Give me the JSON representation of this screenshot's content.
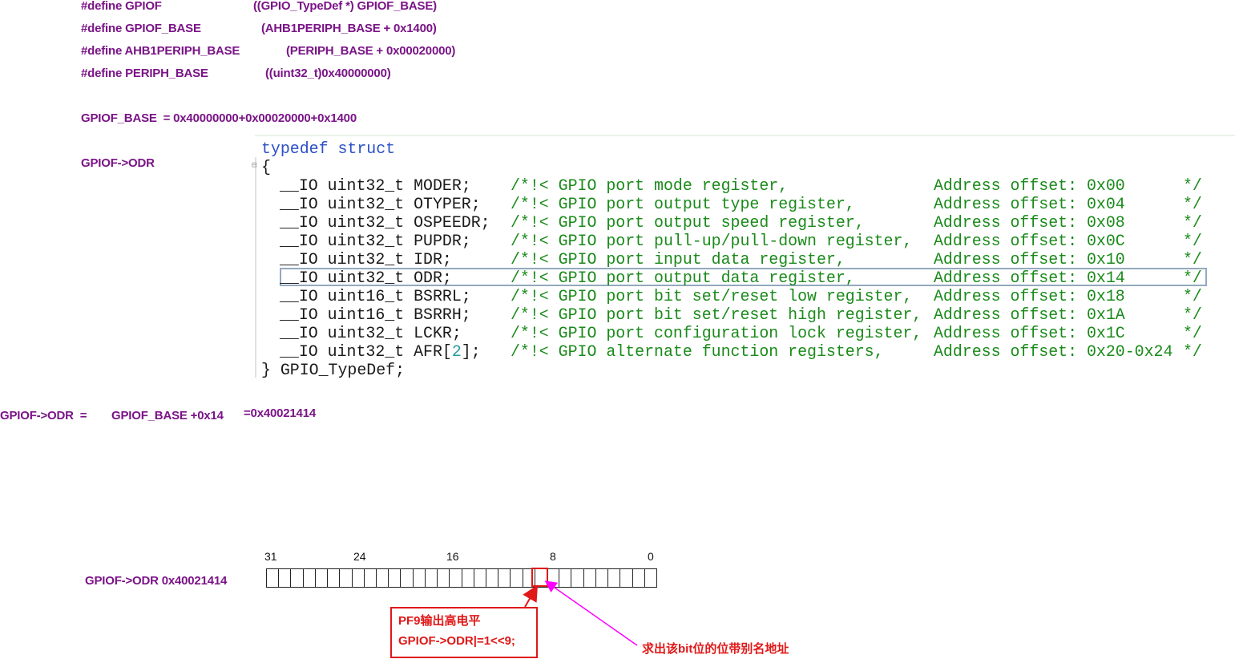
{
  "defines": [
    {
      "name": "#define GPIOF",
      "value": "((GPIO_TypeDef *) GPIOF_BASE)"
    },
    {
      "name": "#define GPIOF_BASE",
      "value": "(AHB1PERIPH_BASE + 0x1400)"
    },
    {
      "name": "#define AHB1PERIPH_BASE",
      "value": "(PERIPH_BASE + 0x00020000)"
    },
    {
      "name": "#define PERIPH_BASE",
      "value": "((uint32_t)0x40000000)"
    }
  ],
  "gpiof_base_calc": "GPIOF_BASE  = 0x40000000+0x00020000+0x1400",
  "gpiof_odr_label": "GPIOF->ODR",
  "code": {
    "header": "typedef struct",
    "open_brace": "{",
    "fold_marker": "⊟",
    "fields": [
      {
        "decl": "__IO uint32_t MODER;",
        "comment": "/*!< GPIO port mode register,",
        "offset": "Address offset: 0x00",
        "end": "*/"
      },
      {
        "decl": "__IO uint32_t OTYPER;",
        "comment": "/*!< GPIO port output type register,",
        "offset": "Address offset: 0x04",
        "end": "*/"
      },
      {
        "decl": "__IO uint32_t OSPEEDR;",
        "comment": "/*!< GPIO port output speed register,",
        "offset": "Address offset: 0x08",
        "end": "*/"
      },
      {
        "decl": "__IO uint32_t PUPDR;",
        "comment": "/*!< GPIO port pull-up/pull-down register,",
        "offset": "Address offset: 0x0C",
        "end": "*/"
      },
      {
        "decl": "__IO uint32_t IDR;",
        "comment": "/*!< GPIO port input data register,",
        "offset": "Address offset: 0x10",
        "end": "*/"
      },
      {
        "decl": "__IO uint32_t ODR;",
        "comment": "/*!< GPIO port output data register,",
        "offset": "Address offset: 0x14",
        "end": "*/"
      },
      {
        "decl": "__IO uint16_t BSRRL;",
        "comment": "/*!< GPIO port bit set/reset low register,",
        "offset": "Address offset: 0x18",
        "end": "*/"
      },
      {
        "decl": "__IO uint16_t BSRRH;",
        "comment": "/*!< GPIO port bit set/reset high register,",
        "offset": "Address offset: 0x1A",
        "end": "*/"
      },
      {
        "decl": "__IO uint32_t LCKR;",
        "comment": "/*!< GPIO port configuration lock register,",
        "offset": "Address offset: 0x1C",
        "end": "*/"
      },
      {
        "decl_pre": "__IO uint32_t AFR[",
        "decl_num": "2",
        "decl_post": "];",
        "comment": "/*!< GPIO alternate function registers,",
        "offset": "Address offset: 0x20-0x24",
        "end": "*/"
      }
    ],
    "footer": "} GPIO_TypeDef;"
  },
  "odr_formula": {
    "lhs": "GPIOF->ODR  =",
    "mid": "GPIOF_BASE +0x14",
    "result": "=0x40021414"
  },
  "register": {
    "label": "GPIOF->ODR 0x40021414",
    "bit_count": 32,
    "bit_labels": [
      "31",
      "24",
      "16",
      "8",
      "0"
    ],
    "highlighted_bit": 9
  },
  "callout": {
    "line1": "PF9输出高电平",
    "line2": "GPIOF->ODR|=1<<9;"
  },
  "bitband_note": "求出该bit位的位带别名地址",
  "colors": {
    "label": "#7a1487",
    "accent_red": "#e01818",
    "magenta_arrow": "#ff00ff",
    "comment": "#1a8a1a",
    "keyword": "#2a4fc7"
  }
}
